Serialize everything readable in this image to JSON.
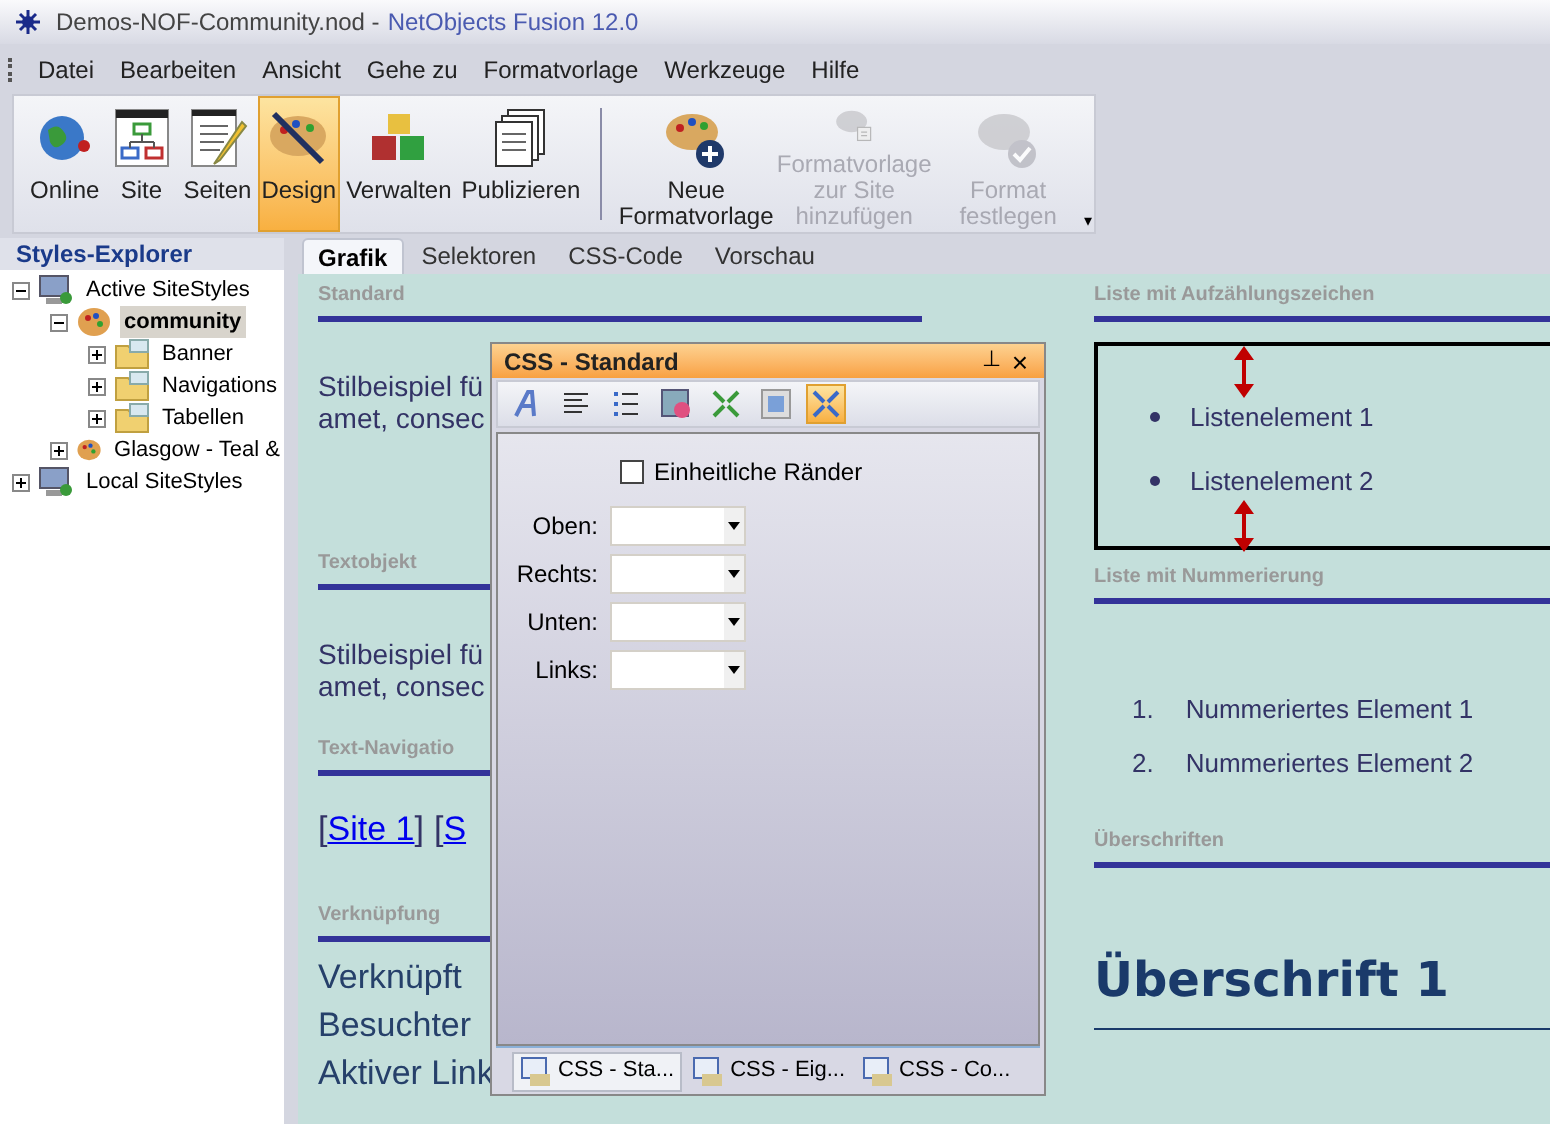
{
  "window": {
    "title_file": "Demos-NOF-Community.nod -",
    "title_app": "NetObjects Fusion 12.0"
  },
  "toolbar_overflow": "▾",
  "menu": [
    "Datei",
    "Bearbeiten",
    "Ansicht",
    "Gehe zu",
    "Formatvorlage",
    "Werkzeuge",
    "Hilfe"
  ],
  "toolbar": [
    {
      "kind": "globe",
      "label": "Online",
      "selected": false,
      "disabled": false
    },
    {
      "kind": "sitemap",
      "label": "Site",
      "selected": false,
      "disabled": false
    },
    {
      "kind": "page",
      "label": "Seiten",
      "selected": false,
      "disabled": false
    },
    {
      "kind": "palette",
      "label": "Design",
      "selected": true,
      "disabled": false
    },
    {
      "kind": "cubes",
      "label": "Verwalten",
      "selected": false,
      "disabled": false
    },
    {
      "kind": "stack",
      "label": "Publizieren",
      "selected": false,
      "disabled": false
    },
    {
      "kind": "palette-plus",
      "label": "Neue Formatvorlage",
      "selected": false,
      "disabled": false
    },
    {
      "kind": "palette-add",
      "label": "Formatvorlage zur Site hinzufügen",
      "selected": false,
      "disabled": true
    },
    {
      "kind": "palette-check",
      "label": "Format festlegen",
      "selected": false,
      "disabled": true
    }
  ],
  "sidebar": {
    "title": "Styles-Explorer",
    "tree": [
      {
        "kind": "computer",
        "label": "Active SiteStyles",
        "expanded": true,
        "selected": false,
        "children": [
          {
            "kind": "palette",
            "label": "community",
            "expanded": true,
            "selected": true,
            "children": [
              {
                "kind": "folder",
                "label": "Banner",
                "expanded": false,
                "selected": false
              },
              {
                "kind": "folder",
                "label": "Navigations",
                "expanded": false,
                "selected": false
              },
              {
                "kind": "folder",
                "label": "Tabellen",
                "expanded": false,
                "selected": false
              }
            ]
          },
          {
            "kind": "palette",
            "label": "Glasgow - Teal &",
            "expanded": false,
            "selected": false
          }
        ]
      },
      {
        "kind": "computer",
        "label": "Local SiteStyles",
        "expanded": false,
        "selected": false
      }
    ]
  },
  "tabs": [
    {
      "label": "Grafik",
      "selected": true
    },
    {
      "label": "Selektoren",
      "selected": false
    },
    {
      "label": "CSS-Code",
      "selected": false
    },
    {
      "label": "Vorschau",
      "selected": false
    }
  ],
  "left_sections": [
    {
      "kind": "text",
      "heading": "Standard",
      "lines": [
        "Stilbeispiel fü",
        "amet, consec"
      ]
    },
    {
      "kind": "text2",
      "heading": "Textobjekt",
      "lines": [
        "Stilbeispiel fü",
        "amet, consec"
      ]
    },
    {
      "kind": "nav",
      "heading": "Text-Navigatio",
      "open": "[",
      "close": "]",
      "links": [
        "Site 1",
        "S"
      ]
    },
    {
      "kind": "links",
      "heading": "Verknüpfung",
      "lines": [
        "Verknüpft",
        "Besuchter",
        "Aktiver Link"
      ]
    }
  ],
  "right_sections": [
    {
      "kind": "bullets",
      "heading": "Liste mit Aufzählungszeichen",
      "items": [
        "Listenelement 1",
        "Listenelement 2"
      ]
    },
    {
      "kind": "numbered",
      "heading": "Liste mit Nummerierung",
      "items": [
        {
          "number": "1.",
          "text": "Nummeriertes Element 1"
        },
        {
          "number": "2.",
          "text": "Nummeriertes Element 2"
        }
      ]
    },
    {
      "kind": "heading",
      "heading": "Überschriften",
      "text": "Überschrift 1"
    }
  ],
  "panel": {
    "title": "CSS - Standard",
    "pin": "⊥",
    "close": "×",
    "tools": [
      {
        "kind": "font",
        "selected": false
      },
      {
        "kind": "align",
        "selected": false
      },
      {
        "kind": "list",
        "selected": false
      },
      {
        "kind": "image",
        "selected": false
      },
      {
        "kind": "shrink",
        "selected": false
      },
      {
        "kind": "box",
        "selected": false
      },
      {
        "kind": "expand",
        "selected": true
      }
    ],
    "checkbox": {
      "label": "Einheitliche Ränder",
      "checked": false
    },
    "fields": [
      {
        "label": "Oben:"
      },
      {
        "label": "Rechts:"
      },
      {
        "label": "Unten:"
      },
      {
        "label": "Links:"
      }
    ],
    "tabs": [
      {
        "label": "CSS - Sta...",
        "selected": true
      },
      {
        "label": "CSS - Eig...",
        "selected": false
      },
      {
        "label": "CSS - Co...",
        "selected": false
      }
    ]
  }
}
